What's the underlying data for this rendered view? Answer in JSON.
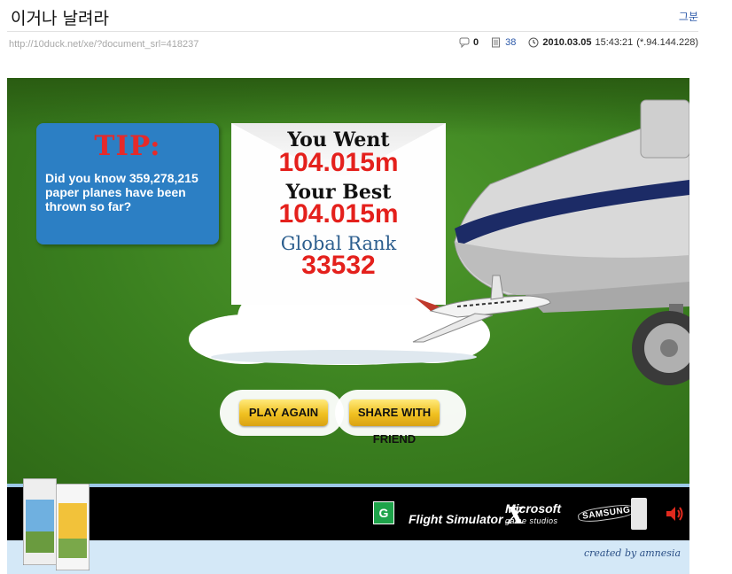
{
  "post": {
    "title": "이거나 날려라",
    "author": "그분",
    "url": "http://10duck.net/xe/?document_srl=418237",
    "comment_count": "0",
    "view_count": "38",
    "date": "2010.03.05",
    "time": "15:43:21",
    "ip": "(*.94.144.228)"
  },
  "game": {
    "tip_title": "TIP:",
    "tip_text": "Did you know 359,278,215 paper planes have been thrown so far?",
    "you_went_label": "You Went",
    "you_went_value": "104.015m",
    "your_best_label": "Your Best",
    "your_best_value": "104.015m",
    "global_rank_label": "Global Rank",
    "global_rank_value": "33532",
    "play_again": "PLAY AGAIN",
    "share": "SHARE WITH FRIEND",
    "credit": "created by amnesia",
    "rating_logo": "G",
    "fs_logo": "Flight Simulator",
    "fs_logo_x": "X",
    "ms_logo": "Microsoft",
    "ms_sub": "game studios",
    "samsung": "SAMSUNG"
  },
  "icons": {
    "comment": "comment-icon",
    "views": "views-icon",
    "clock": "clock-icon",
    "speaker": "speaker-icon"
  },
  "colors": {
    "field_green": "#3a7f1f",
    "tip_blue": "#2c7fc4",
    "value_red": "#e4201c",
    "button_yellow": "#f0c020",
    "link_blue": "#2b58a8"
  }
}
